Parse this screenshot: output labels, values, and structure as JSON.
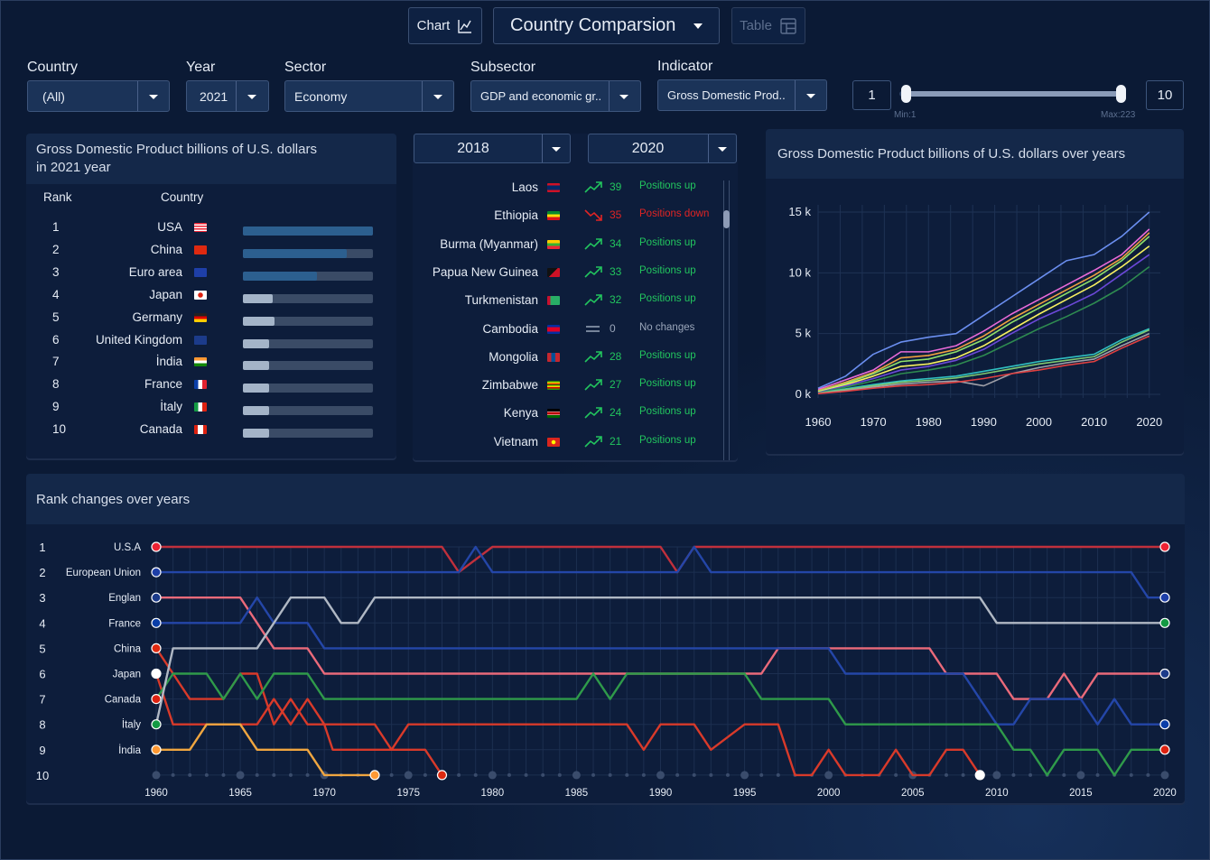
{
  "toolbar": {
    "chart_label": "Chart",
    "view_title": "Country Comparsion",
    "table_label": "Table"
  },
  "filters": {
    "country": {
      "label": "Country",
      "value": "(All)"
    },
    "year": {
      "label": "Year",
      "value": "2021"
    },
    "sector": {
      "label": "Sector",
      "value": "Economy"
    },
    "subsector": {
      "label": "Subsector",
      "value": "GDP and economic gr.."
    },
    "indicator": {
      "label": "Indicator",
      "value": "Gross Domestic Prod.."
    }
  },
  "range": {
    "min_value": "1",
    "max_value": "10",
    "min_caption": "Min:1",
    "max_caption": "Max:223",
    "selected_min": 1,
    "selected_max": 10,
    "bound_min": 1,
    "bound_max": 223
  },
  "ranking": {
    "title_line1": "Gross Domestic Product billions of U.S. dollars",
    "title_line2": "in 2021 year",
    "col_rank": "Rank",
    "col_country": "Country",
    "rows": [
      {
        "rank": "1",
        "country": "USA",
        "flag": "us",
        "share": 1.0
      },
      {
        "rank": "2",
        "country": "China",
        "flag": "cn",
        "share": 0.8
      },
      {
        "rank": "3",
        "country": "Euro area",
        "flag": "eu",
        "share": 0.57
      },
      {
        "rank": "4",
        "country": "Japan",
        "flag": "jp",
        "share": 0.23
      },
      {
        "rank": "5",
        "country": "Germany",
        "flag": "de",
        "share": 0.24
      },
      {
        "rank": "6",
        "country": "United Kingdom",
        "flag": "gb",
        "share": 0.2
      },
      {
        "rank": "7",
        "country": "İndia",
        "flag": "in",
        "share": 0.2
      },
      {
        "rank": "8",
        "country": "France",
        "flag": "fr",
        "share": 0.2
      },
      {
        "rank": "9",
        "country": "İtaly",
        "flag": "it",
        "share": 0.2
      },
      {
        "rank": "10",
        "country": "Canada",
        "flag": "ca",
        "share": 0.2
      }
    ]
  },
  "changes": {
    "year_from": "2018",
    "year_to": "2020",
    "rows": [
      {
        "country": "Laos",
        "flag": "la",
        "dir": "up",
        "position": "39",
        "status": "Positions up"
      },
      {
        "country": "Ethiopia",
        "flag": "et",
        "dir": "down",
        "position": "35",
        "status": "Positions down"
      },
      {
        "country": "Burma (Myanmar)",
        "flag": "mm",
        "dir": "up",
        "position": "34",
        "status": "Positions up"
      },
      {
        "country": "Papua New  Guinea",
        "flag": "pg",
        "dir": "up",
        "position": "33",
        "status": "Positions up"
      },
      {
        "country": "Turkmenistan",
        "flag": "tm",
        "dir": "up",
        "position": "32",
        "status": "Positions up"
      },
      {
        "country": "Cambodia",
        "flag": "kh",
        "dir": "same",
        "position": "0",
        "status": "No changes"
      },
      {
        "country": "Mongolia",
        "flag": "mn",
        "dir": "up",
        "position": "28",
        "status": "Positions up"
      },
      {
        "country": "Zimbabwe",
        "flag": "zw",
        "dir": "up",
        "position": "27",
        "status": "Positions up"
      },
      {
        "country": "Kenya",
        "flag": "ke",
        "dir": "up",
        "position": "24",
        "status": "Positions up"
      },
      {
        "country": "Vietnam",
        "flag": "vn",
        "dir": "up",
        "position": "21",
        "status": "Positions up"
      }
    ]
  },
  "gdp_chart_title": "Gross Domestic Product billions of U.S. dollars over years",
  "rank_chart_title": "Rank changes over years",
  "colors": {
    "up": "#22c55e",
    "down": "#e02424",
    "same": "#9aa6ba",
    "bar_top": "#2c5f8f",
    "bar_low": "#a4b4c8"
  },
  "chart_data": [
    {
      "type": "line",
      "title": "Gross Domestic Product billions of U.S. dollars over years",
      "x": [
        1960,
        1965,
        1970,
        1975,
        1980,
        1985,
        1990,
        1995,
        2000,
        2005,
        2010,
        2015,
        2020
      ],
      "x_ticks": [
        "1960",
        "1970",
        "1980",
        "1990",
        "2000",
        "2010",
        "2020"
      ],
      "y_ticks": [
        "0 k",
        "5 k",
        "10 k",
        "15 k"
      ],
      "ylim": [
        0,
        15000
      ],
      "xlim": [
        1960,
        2022
      ],
      "grid": true,
      "series": [
        {
          "color": "#6b8ff0",
          "values": [
            500,
            1500,
            3300,
            4300,
            4700,
            5000,
            6500,
            8000,
            9500,
            11000,
            11500,
            13000,
            15000
          ]
        },
        {
          "color": "#e86ad8",
          "values": [
            400,
            1200,
            2000,
            3500,
            3500,
            4000,
            5200,
            6600,
            7800,
            9000,
            10200,
            11500,
            13600
          ]
        },
        {
          "color": "#f0a040",
          "values": [
            300,
            1000,
            1800,
            3000,
            3200,
            3700,
            4800,
            6200,
            7400,
            8600,
            9800,
            11200,
            13300
          ]
        },
        {
          "color": "#8ee06a",
          "values": [
            250,
            900,
            1700,
            2700,
            2900,
            3500,
            4500,
            5900,
            7100,
            8300,
            9500,
            11000,
            13000
          ]
        },
        {
          "color": "#f7f060",
          "values": [
            200,
            800,
            1500,
            2300,
            2500,
            3000,
            4000,
            5300,
            6600,
            7800,
            9000,
            10500,
            12200
          ]
        },
        {
          "color": "#6b48d8",
          "values": [
            150,
            700,
            1300,
            2000,
            2300,
            2800,
            3700,
            5000,
            6200,
            7200,
            8300,
            9900,
            11500
          ]
        },
        {
          "color": "#2e8a50",
          "values": [
            120,
            600,
            1100,
            1700,
            2000,
            2400,
            3200,
            4300,
            5400,
            6400,
            7500,
            8800,
            10500
          ]
        },
        {
          "color": "#30c0c0",
          "values": [
            100,
            450,
            800,
            1100,
            1300,
            1500,
            1900,
            2300,
            2700,
            3000,
            3300,
            4500,
            5400
          ]
        },
        {
          "color": "#7ec870",
          "values": [
            90,
            400,
            700,
            1000,
            1150,
            1350,
            1700,
            2100,
            2500,
            2800,
            3100,
            4300,
            5300
          ]
        },
        {
          "color": "#a0a0a8",
          "values": [
            80,
            300,
            600,
            850,
            1000,
            1100,
            700,
            1700,
            2200,
            2600,
            2900,
            4000,
            5000
          ]
        },
        {
          "color": "#e04040",
          "values": [
            60,
            250,
            500,
            700,
            800,
            1000,
            1300,
            1700,
            2000,
            2400,
            2700,
            3800,
            4800
          ]
        }
      ]
    },
    {
      "type": "line",
      "title": "Rank changes over years",
      "x_ticks": [
        "1960",
        "1965",
        "1970",
        "1975",
        "1980",
        "1985",
        "1990",
        "1995",
        "2000",
        "2005",
        "2010",
        "2015",
        "2020"
      ],
      "xlim": [
        1960,
        2020
      ],
      "y_ranks": [
        "1",
        "2",
        "3",
        "4",
        "5",
        "6",
        "7",
        "8",
        "9",
        "10"
      ],
      "series": [
        {
          "name": "U.S.A",
          "flag": "us",
          "color": "#c0303c",
          "endColor": "#f5c8cc",
          "points": [
            [
              1960,
              1
            ],
            [
              1977,
              1
            ],
            [
              1978,
              2
            ],
            [
              1980,
              1
            ],
            [
              1990,
              1
            ],
            [
              1991,
              2
            ],
            [
              1992,
              1
            ],
            [
              2020,
              1
            ]
          ]
        },
        {
          "name": "European Union",
          "flag": "eu",
          "color": "#2446a8",
          "endColor": "#8ab0e8",
          "points": [
            [
              1960,
              2
            ],
            [
              1978,
              2
            ],
            [
              1979,
              1
            ],
            [
              1980,
              2
            ],
            [
              1991,
              2
            ],
            [
              1992,
              1
            ],
            [
              1993,
              2
            ],
            [
              2018,
              2
            ],
            [
              2019,
              3
            ],
            [
              2020,
              3
            ]
          ]
        },
        {
          "name": "Englan",
          "flag": "gb",
          "color": "#ea6a7a",
          "endColor": "#ea6a7a",
          "points": [
            [
              1960,
              3
            ],
            [
              1965,
              3
            ],
            [
              1967,
              5
            ],
            [
              1969,
              5
            ],
            [
              1970,
              6
            ],
            [
              1987,
              6
            ],
            [
              1988,
              6
            ],
            [
              1996,
              6
            ],
            [
              1997,
              5
            ],
            [
              2006,
              5
            ],
            [
              2007,
              6
            ],
            [
              2010,
              6
            ],
            [
              2011,
              7
            ],
            [
              2013,
              7
            ],
            [
              2014,
              6
            ],
            [
              2015,
              7
            ],
            [
              2016,
              6
            ],
            [
              2020,
              6
            ]
          ]
        },
        {
          "name": "France",
          "flag": "fr",
          "color": "#2446a8",
          "endColor": "#8ab0e8",
          "points": [
            [
              1960,
              4
            ],
            [
              1965,
              4
            ],
            [
              1966,
              3
            ],
            [
              1967,
              4
            ],
            [
              1969,
              4
            ],
            [
              1970,
              5
            ],
            [
              2000,
              5
            ],
            [
              2001,
              6
            ],
            [
              2008,
              6
            ],
            [
              2010,
              8
            ],
            [
              2011,
              8
            ],
            [
              2012,
              7
            ],
            [
              2015,
              7
            ],
            [
              2016,
              8
            ],
            [
              2017,
              7
            ],
            [
              2018,
              8
            ],
            [
              2020,
              8
            ]
          ]
        },
        {
          "name": "China",
          "flag": "cn",
          "color": "#d83a2a",
          "endColor": "#d83a2a",
          "points": [
            [
              1960,
              5
            ],
            [
              1961,
              6
            ],
            [
              1962,
              7
            ],
            [
              1964,
              7
            ],
            [
              1965,
              6
            ],
            [
              1966,
              6
            ],
            [
              1967,
              8
            ],
            [
              1968,
              7
            ],
            [
              1969,
              8
            ],
            [
              1970,
              8
            ],
            [
              1970.5,
              9
            ],
            [
              1976,
              9
            ],
            [
              1977,
              10
            ]
          ]
        },
        {
          "name": "Japan",
          "flag": "jp",
          "color": "#d83a2a",
          "endColor": "#d83a2a",
          "points": [
            [
              1960,
              6
            ],
            [
              1961,
              8
            ],
            [
              1962,
              8
            ],
            [
              1963,
              8
            ],
            [
              1965,
              8
            ],
            [
              1966,
              8
            ],
            [
              1967,
              7
            ],
            [
              1968,
              8
            ],
            [
              1969,
              7
            ],
            [
              1970,
              8
            ],
            [
              1973,
              8
            ],
            [
              1974,
              9
            ],
            [
              1975,
              8
            ],
            [
              1980,
              8
            ],
            [
              1983,
              8
            ],
            [
              1988,
              8
            ],
            [
              1989,
              9
            ],
            [
              1990,
              8
            ],
            [
              1992,
              8
            ],
            [
              1993,
              9
            ],
            [
              1995,
              8
            ],
            [
              1997,
              8
            ],
            [
              1998,
              10
            ],
            [
              1999,
              10
            ],
            [
              2000,
              9
            ],
            [
              2001,
              10
            ],
            [
              2003,
              10
            ],
            [
              2004,
              9
            ],
            [
              2005,
              10
            ],
            [
              2006,
              10
            ],
            [
              2007,
              9
            ],
            [
              2008,
              9
            ],
            [
              2009,
              10
            ]
          ]
        },
        {
          "name": "Canada",
          "flag": "ca",
          "color": "#2f9a4a",
          "endColor": "#2f9a4a",
          "points": [
            [
              1960,
              7
            ],
            [
              1961,
              6
            ],
            [
              1963,
              6
            ],
            [
              1964,
              7
            ],
            [
              1965,
              6
            ],
            [
              1966,
              7
            ],
            [
              1967,
              6
            ],
            [
              1969,
              6
            ],
            [
              1970,
              7
            ],
            [
              1985,
              7
            ],
            [
              1986,
              6
            ],
            [
              1987,
              7
            ],
            [
              1988,
              6
            ],
            [
              1995,
              6
            ],
            [
              1996,
              7
            ],
            [
              2000,
              7
            ],
            [
              2001,
              8
            ],
            [
              2010,
              8
            ],
            [
              2011,
              9
            ],
            [
              2012,
              9
            ],
            [
              2013,
              10
            ],
            [
              2014,
              9
            ],
            [
              2016,
              9
            ],
            [
              2017,
              10
            ],
            [
              2018,
              9
            ],
            [
              2020,
              9
            ]
          ]
        },
        {
          "name": "İtaly",
          "flag": "it",
          "color": "#b0b8c4",
          "endColor": "#e8ecf2",
          "points": [
            [
              1960,
              8
            ],
            [
              1961,
              5
            ],
            [
              1966,
              5
            ],
            [
              1967,
              4
            ],
            [
              1968,
              3
            ],
            [
              1970,
              3
            ],
            [
              1971,
              4
            ],
            [
              1972,
              4
            ],
            [
              1973,
              3
            ],
            [
              2009,
              3
            ],
            [
              2010,
              4
            ],
            [
              2020,
              4
            ]
          ]
        },
        {
          "name": "İndia",
          "flag": "in",
          "color": "#f0a640",
          "endColor": "#f0a640",
          "points": [
            [
              1960,
              9
            ],
            [
              1962,
              9
            ],
            [
              1963,
              8
            ],
            [
              1964,
              8
            ],
            [
              1965,
              8
            ],
            [
              1966,
              9
            ],
            [
              1969,
              9
            ],
            [
              1970,
              10
            ],
            [
              1973,
              10
            ]
          ]
        }
      ]
    }
  ]
}
